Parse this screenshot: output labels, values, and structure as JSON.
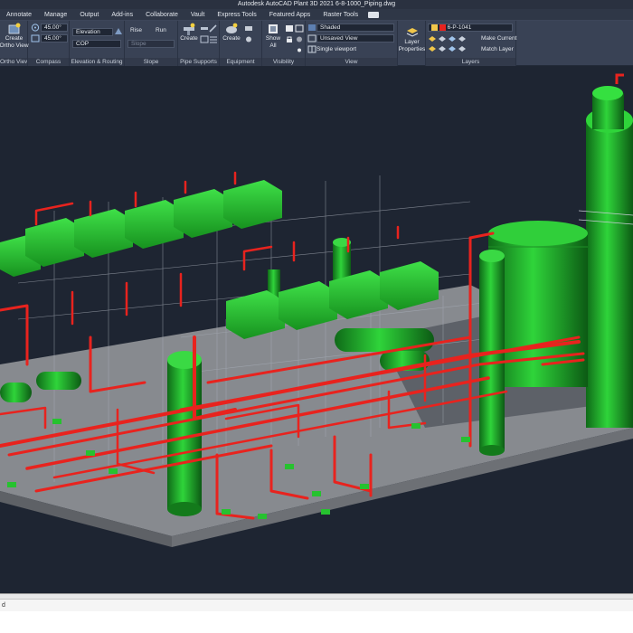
{
  "window": {
    "title": "Autodesk AutoCAD Plant 3D 2021     6-8-1000_Piping.dwg"
  },
  "tabs": [
    {
      "label": "Annotate"
    },
    {
      "label": "Manage"
    },
    {
      "label": "Output"
    },
    {
      "label": "Add-ins"
    },
    {
      "label": "Collaborate"
    },
    {
      "label": "Vault"
    },
    {
      "label": "Express Tools"
    },
    {
      "label": "Featured Apps"
    },
    {
      "label": "Raster Tools"
    }
  ],
  "ribbon": {
    "ortho": {
      "create_label": "Create",
      "ortho_view_label": "Ortho View",
      "panel_title": "Ortho Views"
    },
    "compass": {
      "angle1": "45.00°",
      "angle2": "45.00°",
      "panel_title": "Compass"
    },
    "elevation": {
      "elevation_value": "Elevation",
      "cop_value": "COP",
      "panel_title": "Elevation & Routing"
    },
    "slope": {
      "rise_label": "Rise",
      "run_label": "Run",
      "slope_value": "Slope",
      "panel_title": "Slope"
    },
    "pipe_supports": {
      "create_label": "Create",
      "panel_title": "Pipe Supports"
    },
    "equipment": {
      "create_label": "Create",
      "panel_title": "Equipment"
    },
    "visibility": {
      "show_label": "Show",
      "all_label": "All",
      "panel_title": "Visibility"
    },
    "view": {
      "visual_style": "Shaded",
      "named_view": "Unsaved View",
      "viewport": "Single viewport",
      "panel_title": "View"
    },
    "layer_properties": {
      "label1": "Layer",
      "label2": "Properties"
    },
    "layers": {
      "current_layer": "6-P-1041",
      "make_current_label": "Make Current",
      "match_layer_label": "Match Layer",
      "panel_title": "Layers"
    }
  },
  "colors": {
    "pipe": "#e8231e",
    "equipment": "#1fb526",
    "deck": "#8c8f93",
    "background": "#1e2532"
  },
  "command_line": {
    "prompt": "d"
  }
}
